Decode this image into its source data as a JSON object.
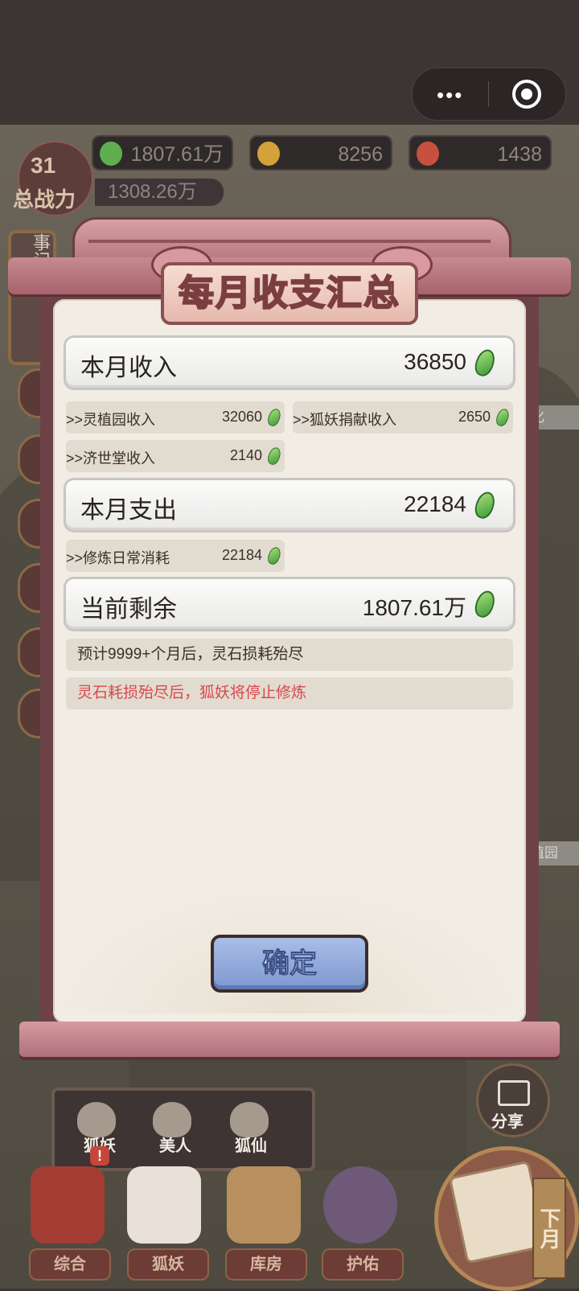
{
  "mini_program": {
    "menu_dots": "•••",
    "close_icon": "target-icon"
  },
  "resources": [
    {
      "icon": "green-spirit-stone-icon",
      "value": "1807.61万",
      "color": "#5fae4f"
    },
    {
      "icon": "gold-coin-icon",
      "value": "8256",
      "color": "#d4a23b"
    },
    {
      "icon": "red-gem-icon",
      "value": "1438",
      "color": "#c8503f"
    }
  ],
  "power": {
    "level": "31",
    "label": "总战力",
    "value": "1308.26万"
  },
  "side_tags": {
    "top": "化",
    "bottom": "植园"
  },
  "left_box_text": "事记",
  "dialog": {
    "title": "每月收支汇总",
    "income": {
      "label": "本月收入",
      "value": "36850",
      "items": [
        {
          "label": ">>灵植园收入",
          "value": "32060"
        },
        {
          "label": ">>狐妖捐献收入",
          "value": "2650"
        },
        {
          "label": ">>济世堂收入",
          "value": "2140"
        }
      ]
    },
    "expense": {
      "label": "本月支出",
      "value": "22184",
      "items": [
        {
          "label": ">>修炼日常消耗",
          "value": "22184"
        }
      ]
    },
    "balance": {
      "label": "当前剩余",
      "value": "1807.61万"
    },
    "notes": {
      "forecast": "预计9999+个月后，灵石损耗殆尽",
      "warning": "灵石耗损殆尽后，狐妖将停止修炼"
    },
    "warning_color": "#d9484a",
    "confirm_label": "确定"
  },
  "share": {
    "label": "分享",
    "icon": "share-icon"
  },
  "filters": [
    {
      "label": "狐妖",
      "icon": "fox-silhouette-icon"
    },
    {
      "label": "美人",
      "icon": "beauty-silhouette-icon"
    },
    {
      "label": "狐仙",
      "icon": "fox-immortal-silhouette-icon"
    }
  ],
  "nav": [
    {
      "label": "综合",
      "icon": "shrine-gate-icon",
      "badge": "!"
    },
    {
      "label": "狐妖",
      "icon": "fox-mask-icon"
    },
    {
      "label": "库房",
      "icon": "scroll-chest-icon"
    },
    {
      "label": "护佑",
      "icon": "lotus-icon"
    }
  ],
  "next_month": {
    "label": "下月",
    "icon": "calendar-icon"
  }
}
